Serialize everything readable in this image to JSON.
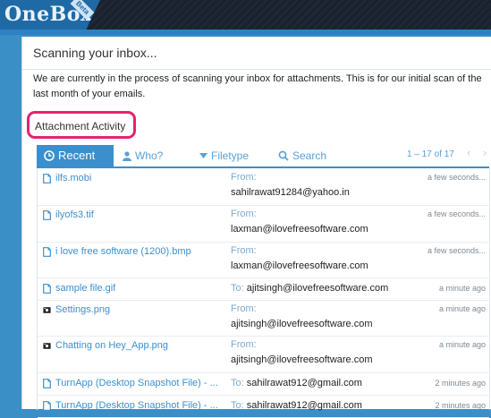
{
  "app": {
    "logo": "OneBox",
    "badge": "Beta"
  },
  "panel": {
    "title": "Scanning your inbox...",
    "message": "We are currently in the process of scanning your inbox for attachments. This is for our initial scan of the last month of your emails.",
    "section_heading": "Attachment Activity"
  },
  "tabs": {
    "recent": "Recent",
    "who": "Who?",
    "filetype": "Filetype",
    "search": "Search"
  },
  "pager": {
    "text": "1 – 17 of 17",
    "prev": "‹",
    "next": "›"
  },
  "labels": {
    "from": "From:",
    "to": "To:"
  },
  "rows": [
    {
      "file": "ilfs.mobi",
      "icon": "document-icon",
      "kind": "from",
      "address": "sahilrawat91284@yahoo.in",
      "time": "a few seconds..."
    },
    {
      "file": "ilyofs3.tif",
      "icon": "document-icon",
      "kind": "from",
      "address": "laxman@ilovefreesoftware.com",
      "time": "a few seconds..."
    },
    {
      "file": "i love free software (1200).bmp",
      "icon": "document-icon",
      "kind": "from",
      "address": "laxman@ilovefreesoftware.com",
      "time": "a few seconds..."
    },
    {
      "file": "sample file.gif",
      "icon": "document-icon",
      "kind": "to",
      "address": "ajitsingh@ilovefreesoftware.com",
      "time": "a minute ago"
    },
    {
      "file": "Settings.png",
      "icon": "image-icon",
      "kind": "from",
      "address": "ajitsingh@ilovefreesoftware.com",
      "time": "a minute ago"
    },
    {
      "file": "Chatting on Hey_App.png",
      "icon": "image-icon",
      "kind": "from",
      "address": "ajitsingh@ilovefreesoftware.com",
      "time": "a minute ago"
    },
    {
      "file": "TurnApp (Desktop Snapshot File) - ...",
      "icon": "document-icon",
      "kind": "to",
      "address": "sahilrawat912@gmail.com",
      "time": "2 minutes ago"
    },
    {
      "file": "TurnApp (Desktop Snapshot File) - ...",
      "icon": "document-icon",
      "kind": "to",
      "address": "sahilrawat912@gmail.com",
      "time": "2 minutes ago"
    }
  ],
  "colors": {
    "accent": "#3b8fcc",
    "highlight": "#e3246f",
    "header": "#1a2230",
    "page": "#3a8fc7"
  }
}
